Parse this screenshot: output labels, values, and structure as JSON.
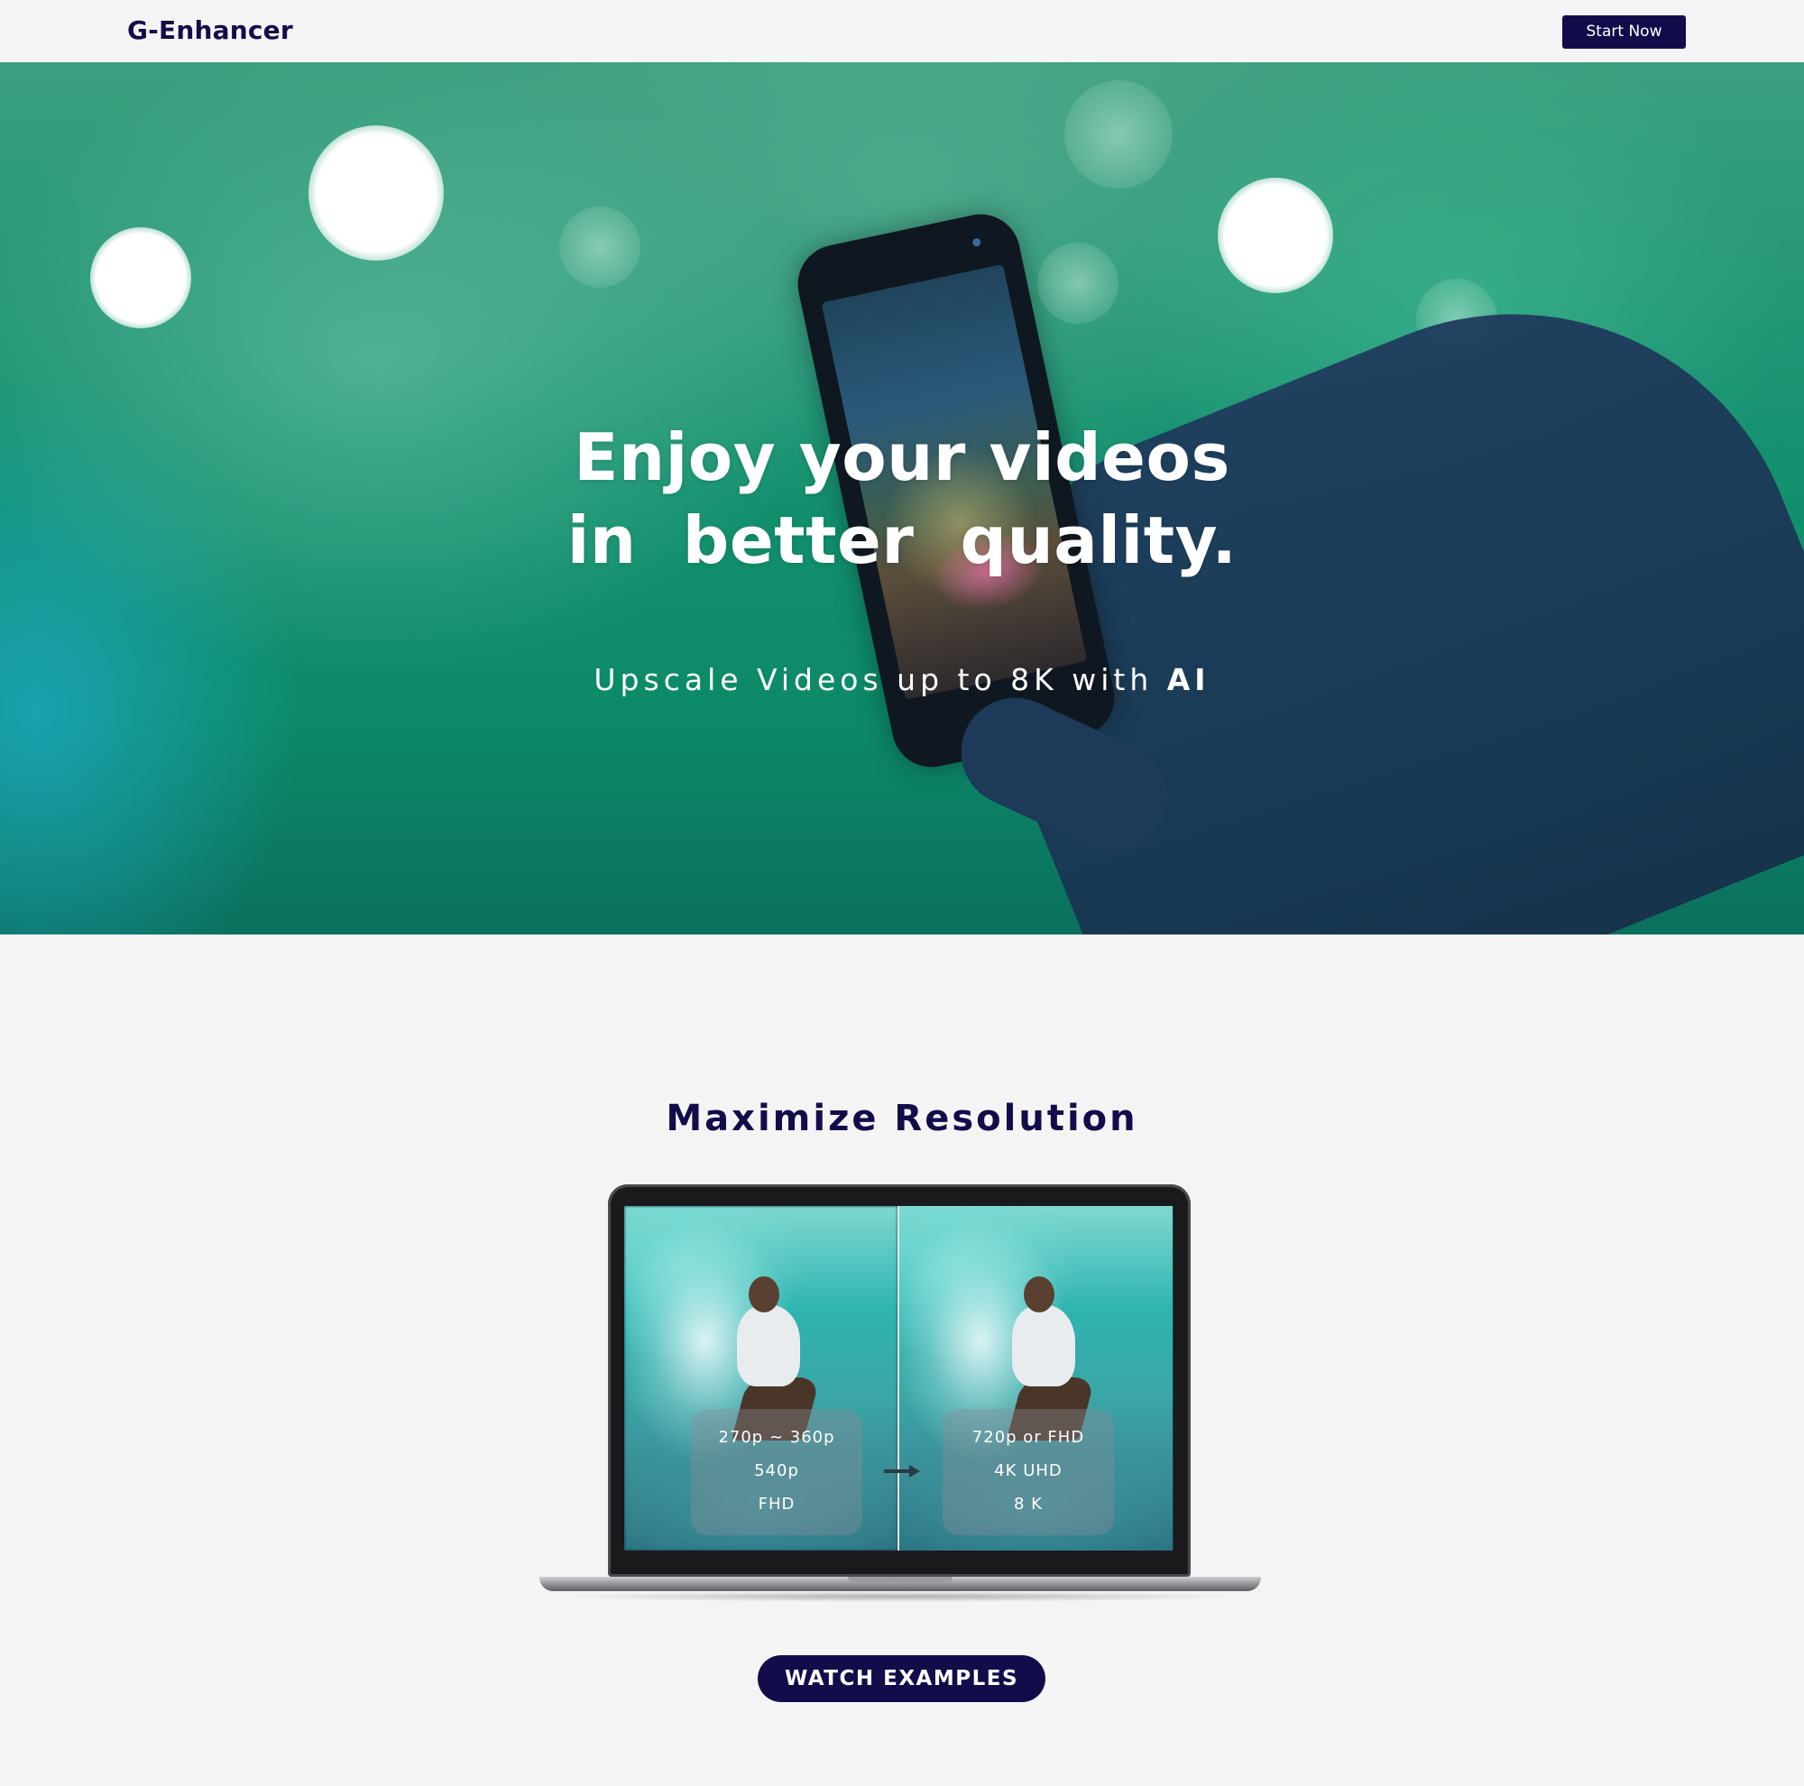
{
  "header": {
    "logo": "G-Enhancer",
    "cta_label": "Start Now"
  },
  "hero": {
    "title_line1": "Enjoy your videos",
    "title_line2": "in  better  quality.",
    "subtitle_prefix": "Upscale Videos up to 8K with ",
    "subtitle_emphasis": "AI"
  },
  "resolution_section": {
    "heading": "Maximize Resolution",
    "before": [
      "270p ~ 360p",
      "540p",
      "FHD"
    ],
    "after": [
      "720p or FHD",
      "4K UHD",
      "8 K"
    ],
    "cta_label": "WATCH EXAMPLES"
  },
  "colors": {
    "brand_navy": "#120d4a",
    "hero_green": "#14916f",
    "background": "#f4f4f4"
  },
  "icons": {
    "arrow": "arrow-right-icon"
  }
}
